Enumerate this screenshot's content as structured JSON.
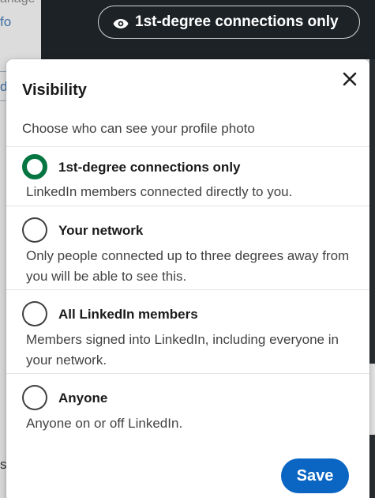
{
  "background": {
    "left_fragments": [
      "anage",
      "fo",
      "d",
      "s"
    ],
    "topbar": {
      "pill_icon": "eye-icon",
      "pill_label": "1st-degree connections only"
    }
  },
  "modal": {
    "title": "Visibility",
    "close_icon": "close-icon",
    "subtitle": "Choose who can see your profile photo",
    "options": [
      {
        "label": "1st-degree connections only",
        "description": "LinkedIn members connected directly to you.",
        "selected": true
      },
      {
        "label": "Your network",
        "description": "Only people connected up to three degrees away from you will be able to see this.",
        "selected": false
      },
      {
        "label": "All LinkedIn members",
        "description": "Members signed into LinkedIn, including everyone in your network.",
        "selected": false
      },
      {
        "label": "Anyone",
        "description": "Anyone on or off LinkedIn.",
        "selected": false
      }
    ],
    "save_label": "Save"
  },
  "colors": {
    "selected_radio": "#057642",
    "primary_button": "#0a66c2",
    "topbar_bg": "#1d2226"
  }
}
